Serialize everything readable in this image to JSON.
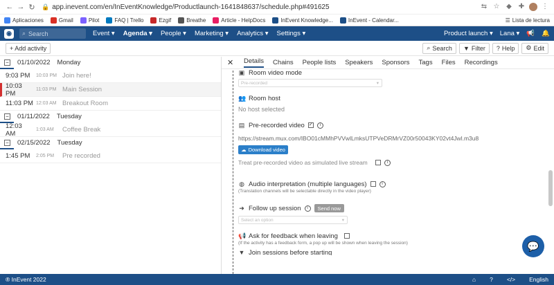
{
  "browser": {
    "url": "app.inevent.com/en/InEventKnowledge/Productlaunch-1641848637/schedule.php#491625",
    "bookmarks": [
      {
        "label": "Aplicaciones",
        "color": "#4285f4"
      },
      {
        "label": "Gmail",
        "color": "#d93025"
      },
      {
        "label": "Pilot",
        "color": "#7b61ff"
      },
      {
        "label": "FAQ | Trello",
        "color": "#0079bf"
      },
      {
        "label": "Ezgif",
        "color": "#c62828"
      },
      {
        "label": "Breathe",
        "color": "#555555"
      },
      {
        "label": "Article - HelpDocs",
        "color": "#e91e63"
      },
      {
        "label": "InEvent Knowledge...",
        "color": "#1d4f87"
      },
      {
        "label": "InEvent - Calendar...",
        "color": "#1d4f87"
      }
    ],
    "reading_list": "Lista de lectura"
  },
  "appnav": {
    "search_placeholder": "Search",
    "items": [
      {
        "label": "Event ▾",
        "active": false
      },
      {
        "label": "Agenda ▾",
        "active": true
      },
      {
        "label": "People ▾",
        "active": false
      },
      {
        "label": "Marketing ▾",
        "active": false
      },
      {
        "label": "Analytics ▾",
        "active": false
      },
      {
        "label": "Settings ▾",
        "active": false
      }
    ],
    "event_name": "Product launch ▾",
    "user": "Lana ▾"
  },
  "toolbar": {
    "add_activity": "+ Add activity",
    "search": "Search",
    "filter": "Filter",
    "help": "Help",
    "edit": "Edit"
  },
  "days": [
    {
      "date": "01/10/2022",
      "weekday": "Monday",
      "items": [
        {
          "time": "9:03 PM",
          "local": "10:03 PM",
          "name": "Join here!",
          "selected": false
        },
        {
          "time": "10:03 PM",
          "local": "11:03 PM",
          "name": "Main Session",
          "selected": true
        },
        {
          "time": "11:03 PM",
          "local": "12:03 AM",
          "name": "Breakout Room",
          "selected": false
        }
      ]
    },
    {
      "date": "01/11/2022",
      "weekday": "Tuesday",
      "items": [
        {
          "time": "12:03 AM",
          "local": "1:03 AM",
          "name": "Coffee Break",
          "selected": false
        }
      ]
    },
    {
      "date": "02/15/2022",
      "weekday": "Tuesday",
      "items": [
        {
          "time": "1:45 PM",
          "local": "2:05 PM",
          "name": "Pre recorded",
          "selected": false
        }
      ]
    }
  ],
  "detail": {
    "tabs": [
      "Details",
      "Chains",
      "People lists",
      "Speakers",
      "Sponsors",
      "Tags",
      "Files",
      "Recordings"
    ],
    "room_video_mode_label": "Room video mode",
    "room_video_mode_value": "Pre-recorded",
    "room_host_label": "Room host",
    "room_host_value": "No host selected",
    "prerecorded_label": "Pre-recorded video",
    "video_url": "https://stream.mux.com/IBO01cMMhPVVwlLmksUTPVeDRMrVZ00r50043KY02vt4Jwl.m3u8",
    "download_label": "Download video",
    "simulated_live_label": "Treat pre-recorded video as simulated live stream",
    "audio_label": "Audio interpretation (multiple languages)",
    "audio_hint": "(Translation channels will be selectable directly in the video player)",
    "followup_label": "Follow up session",
    "send_now": "Send now",
    "followup_placeholder": "Select an option",
    "feedback_label": "Ask for feedback when leaving",
    "feedback_hint": "(If the activity has a feedback form, a pop up will be shown when leaving the session)",
    "join_label": "Join sessions before starting"
  },
  "footer": {
    "brand": "® InEvent 2022",
    "language": "English"
  }
}
